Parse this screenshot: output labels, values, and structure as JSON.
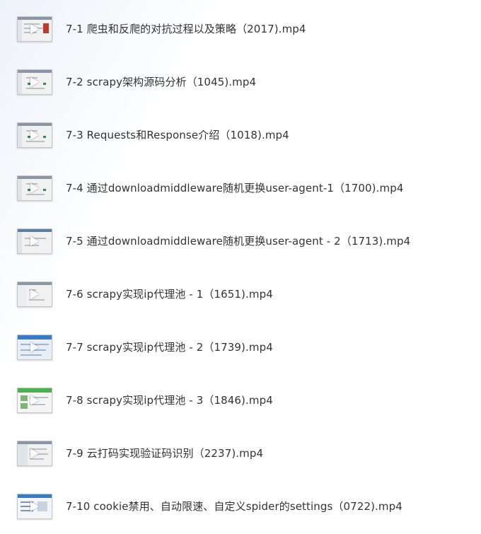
{
  "files": [
    {
      "name": "7-1  爬虫和反爬的对抗过程以及策略（2017).mp4",
      "thumbnail_icon": "video-thumbnail-icon",
      "thumb_accent": "#c0392b"
    },
    {
      "name": "7-2 scrapy架构源码分析（1045).mp4",
      "thumbnail_icon": "video-thumbnail-icon",
      "thumb_accent": "#2e8b57"
    },
    {
      "name": "7-3 Requests和Response介绍（1018).mp4",
      "thumbnail_icon": "video-thumbnail-icon",
      "thumb_accent": "#2e8b57"
    },
    {
      "name": "7-4 通过downloadmiddleware随机更换user-agent-1（1700).mp4",
      "thumbnail_icon": "video-thumbnail-icon",
      "thumb_accent": "#2e8b57"
    },
    {
      "name": "7-5 通过downloadmiddleware随机更换user-agent - 2（1713).mp4",
      "thumbnail_icon": "video-thumbnail-icon",
      "thumb_accent": "#7a8aa0"
    },
    {
      "name": "7-6 scrapy实现ip代理池 - 1（1651).mp4",
      "thumbnail_icon": "video-thumbnail-icon",
      "thumb_accent": "#7a8aa0"
    },
    {
      "name": "7-7 scrapy实现ip代理池 - 2（1739).mp4",
      "thumbnail_icon": "video-thumbnail-icon",
      "thumb_accent": "#3a7bbf"
    },
    {
      "name": "7-8 scrapy实现ip代理池 - 3（1846).mp4",
      "thumbnail_icon": "video-thumbnail-icon",
      "thumb_accent": "#4caf50"
    },
    {
      "name": "7-9 云打码实现验证码识别（2237).mp4",
      "thumbnail_icon": "video-thumbnail-icon",
      "thumb_accent": "#7a8aa0"
    },
    {
      "name": "7-10 cookie禁用、自动限速、自定义spider的settings（0722).mp4",
      "thumbnail_icon": "video-thumbnail-icon",
      "thumb_accent": "#3a7bbf"
    }
  ]
}
